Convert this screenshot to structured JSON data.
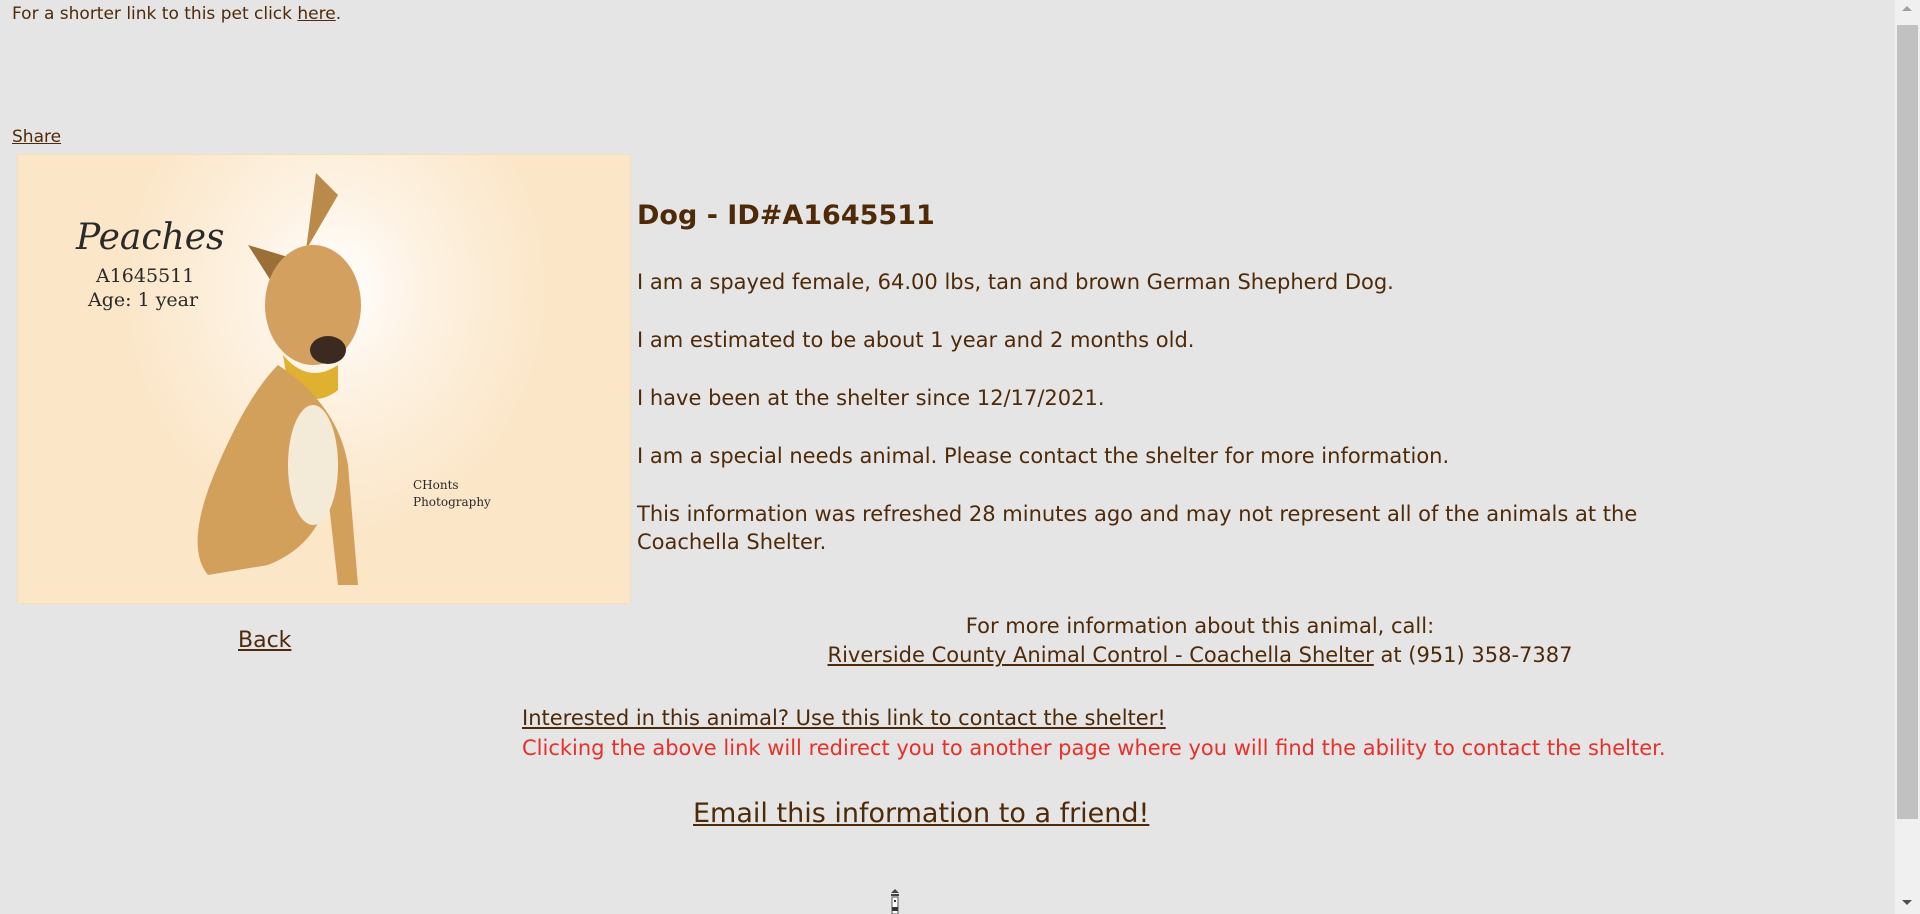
{
  "top": {
    "short_link_prefix": "For a shorter link to this pet click ",
    "short_link_label": "here",
    "short_link_suffix": ".",
    "share_label": "Share"
  },
  "photo": {
    "name": "Peaches",
    "id": "A1645511",
    "age": "Age: 1 year",
    "credit_line1": "CHonts",
    "credit_line2": "Photography"
  },
  "back_label": "Back",
  "details": {
    "title": "Dog - ID#A1645511",
    "lines": [
      "I am a spayed female, 64.00 lbs, tan and brown German Shepherd Dog.",
      "I am estimated to be about 1 year and 2 months old.",
      "I have been at the shelter since 12/17/2021.",
      "I am a special needs animal. Please contact the shelter for more information.",
      "This information was refreshed 28 minutes ago and may not represent all of the animals at the",
      "Coachella Shelter."
    ]
  },
  "contact": {
    "intro": "For more information about this animal, call:",
    "shelter_link": "Riverside County Animal Control - Coachella Shelter",
    "phone_text": " at (951) 358-7387"
  },
  "interest": {
    "link": "Interested in this animal? Use this link to contact the shelter!",
    "note": "Clicking the above link will redirect you to another page where you will find the ability to contact the shelter.",
    "note_color": "#e8302a"
  },
  "email_link": "Email this information to a friend!",
  "colors": {
    "text": "#4f2a08",
    "background": "#e5e5e5"
  }
}
